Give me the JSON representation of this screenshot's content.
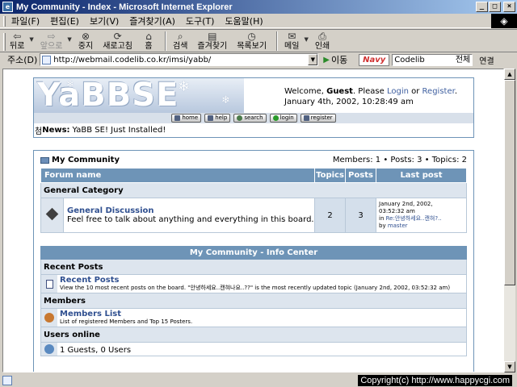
{
  "window": {
    "title": "My Community - Index - Microsoft Internet Explorer",
    "buttons": {
      "minimize": "_",
      "maximize": "□",
      "close": "×"
    }
  },
  "menu": [
    "파일(F)",
    "편집(E)",
    "보기(V)",
    "즐겨찾기(A)",
    "도구(T)",
    "도움말(H)"
  ],
  "toolbar": {
    "back": "뒤로",
    "forward": "앞으로",
    "stop": "중지",
    "refresh": "새로고침",
    "home": "홈",
    "search": "검색",
    "favorites": "즐겨찾기",
    "history": "목록보기",
    "mail": "메일",
    "print": "인쇄"
  },
  "address": {
    "label": "주소(D)",
    "url": "http://webmail.codelib.co.kr/imsi/yabb/",
    "go": "이동",
    "navy_logo": "Navy",
    "navy_query": "Codelib",
    "navy_scope": "전체",
    "links": "연결"
  },
  "status": {
    "copyright": "Copyright(c) http://www.happycgi.com"
  },
  "header": {
    "logo": "YaBBSE",
    "welcome_prefix": "Welcome,",
    "user": "Guest",
    "please": ". Please",
    "login": "Login",
    "or": "or",
    "register": "Register",
    "register_suffix": ".",
    "datetime": "January 4th, 2002, 10:28:49 am",
    "nav": [
      "home",
      "help",
      "search",
      "login",
      "register"
    ]
  },
  "news": {
    "icon": "첨",
    "label": "News:",
    "text": "YaBB SE! Just Installed!"
  },
  "forum": {
    "name": "My Community",
    "stats": "Members: 1  •  Posts: 3  •  Topics: 2",
    "columns": {
      "name": "Forum name",
      "topics": "Topics",
      "posts": "Posts",
      "last": "Last post"
    },
    "category": "General Category",
    "board": {
      "title": "General Discussion",
      "desc": "Feel free to talk about anything and everything in this board.",
      "topics": "2",
      "posts": "3",
      "last_date": "January 2nd, 2002,",
      "last_time": "03:52:32 am",
      "last_in": "in",
      "last_topic": "Re:안녕하세요..캔혀?..",
      "last_by": "by",
      "last_user": "master"
    }
  },
  "info": {
    "header": "My Community - Info Center",
    "recent_section": "Recent Posts",
    "recent_title": "Recent Posts",
    "recent_desc": "View the 10 most recent posts on the board. \"안녕하세요..캔혀나요..??\" is the most recently updated topic (January 2nd, 2002, 03:52:32 am)",
    "members_section": "Members",
    "members_title": "Members List",
    "members_desc": "List of registered Members and Top 15 Posters.",
    "users_section": "Users online",
    "users_text": "1 Guests, 0 Users"
  }
}
